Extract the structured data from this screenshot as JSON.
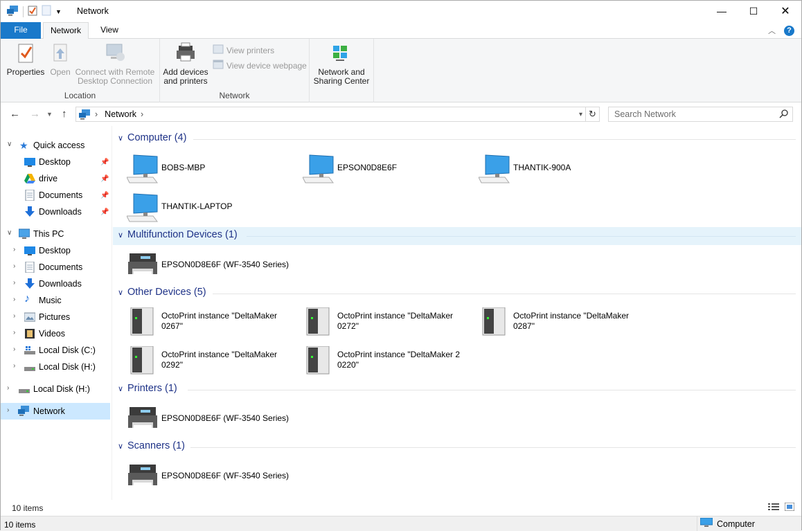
{
  "window": {
    "title": "Network"
  },
  "tabs": [
    {
      "label": "File"
    },
    {
      "label": "Network"
    },
    {
      "label": "View"
    }
  ],
  "ribbon": {
    "location": {
      "label": "Location",
      "properties": "Properties",
      "open": "Open",
      "connect_line1": "Connect with Remote",
      "connect_line2": "Desktop Connection"
    },
    "network": {
      "label": "Network",
      "add_line1": "Add devices",
      "add_line2": "and printers",
      "view_printers": "View printers",
      "view_webpage": "View device webpage",
      "nsc_line1": "Network and",
      "nsc_line2": "Sharing Center"
    }
  },
  "address": {
    "path": "Network",
    "search_placeholder": "Search Network"
  },
  "nav": {
    "quick_access": "Quick access",
    "quick": [
      "Desktop",
      "drive",
      "Documents",
      "Downloads"
    ],
    "this_pc": "This PC",
    "pc": [
      "Desktop",
      "Documents",
      "Downloads",
      "Music",
      "Pictures",
      "Videos",
      "Local Disk (C:)",
      "Local Disk (H:)"
    ],
    "local_disk_h": "Local Disk (H:)",
    "network": "Network"
  },
  "groups": {
    "computer": {
      "title": "Computer (4)",
      "items": [
        "BOBS-MBP",
        "EPSON0D8E6F",
        "THANTIK-900A",
        "THANTIK-LAPTOP"
      ]
    },
    "multifunction": {
      "title": "Multifunction Devices (1)",
      "items": [
        "EPSON0D8E6F (WF-3540 Series)"
      ]
    },
    "other": {
      "title": "Other Devices (5)",
      "items": [
        {
          "l1": "OctoPrint instance \"DeltaMaker",
          "l2": "0267\""
        },
        {
          "l1": "OctoPrint instance \"DeltaMaker",
          "l2": "0272\""
        },
        {
          "l1": "OctoPrint instance \"DeltaMaker",
          "l2": "0287\""
        },
        {
          "l1": "OctoPrint instance \"DeltaMaker",
          "l2": "0292\""
        },
        {
          "l1": "OctoPrint instance \"DeltaMaker 2",
          "l2": "0220\""
        }
      ]
    },
    "printers": {
      "title": "Printers (1)",
      "items": [
        "EPSON0D8E6F (WF-3540 Series)"
      ]
    },
    "scanners": {
      "title": "Scanners (1)",
      "items": [
        "EPSON0D8E6F (WF-3540 Series)"
      ]
    }
  },
  "status": {
    "count": "10 items",
    "count_bottom": "10 items",
    "zone": "Computer"
  }
}
